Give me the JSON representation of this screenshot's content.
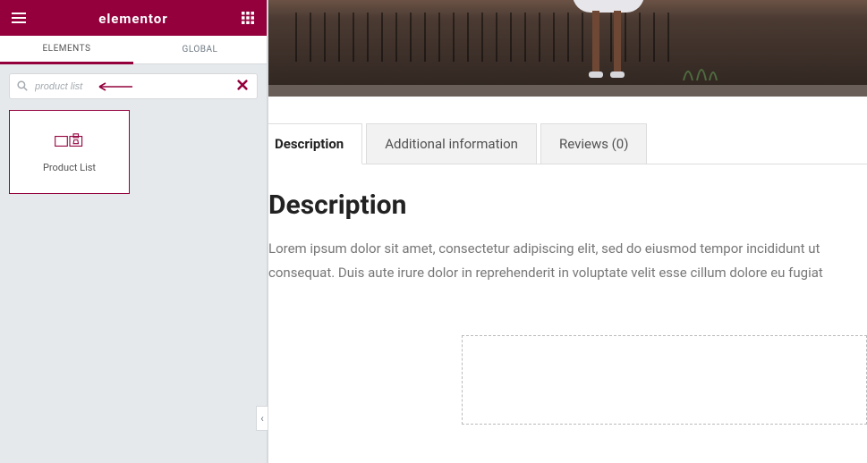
{
  "colors": {
    "accent": "#93003c"
  },
  "sidebar": {
    "brand": "elementor",
    "tabs": {
      "elements": "ELEMENTS",
      "global": "GLOBAL",
      "active": "elements"
    },
    "search": {
      "placeholder": "product list",
      "value": "product list"
    },
    "widgets": [
      {
        "id": "product-list",
        "label": "Product List"
      }
    ]
  },
  "collapse_glyph": "‹",
  "product": {
    "tabs": [
      {
        "id": "description",
        "label": "Description",
        "active": true
      },
      {
        "id": "additional",
        "label": "Additional information",
        "active": false
      },
      {
        "id": "reviews",
        "label": "Reviews (0)",
        "active": false
      }
    ],
    "heading": "Description",
    "body": "Lorem ipsum dolor sit amet, consectetur adipiscing elit, sed do eiusmod tempor incididunt ut consequat. Duis aute irure dolor in reprehenderit in voluptate velit esse cillum dolore eu fugiat"
  }
}
